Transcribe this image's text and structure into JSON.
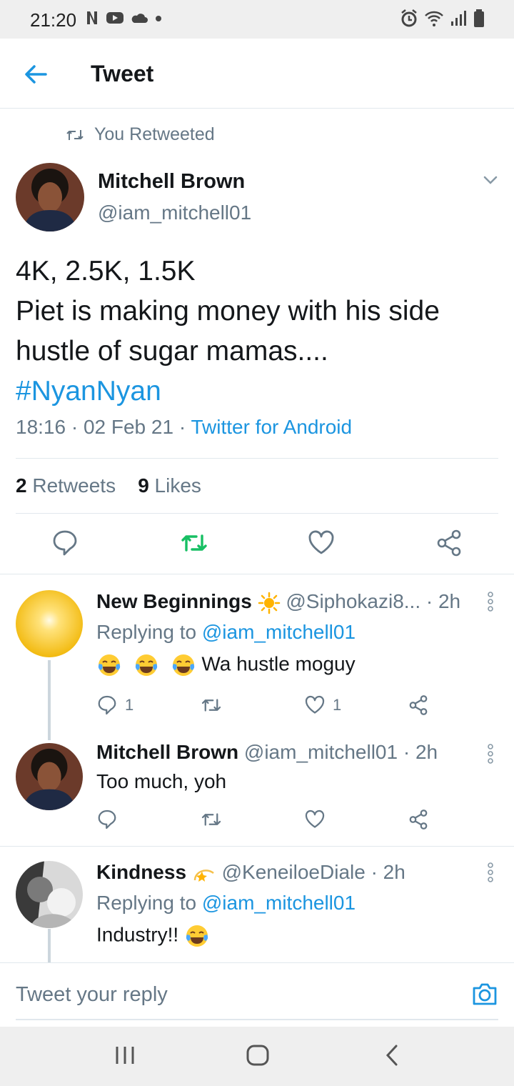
{
  "status_bar": {
    "time": "21:20"
  },
  "app_bar": {
    "title": "Tweet"
  },
  "tweet": {
    "retweet_context": "You Retweeted",
    "author_name": "Mitchell Brown",
    "author_handle": "@iam_mitchell01",
    "text_lines": [
      "4K, 2.5K, 1.5K",
      "Piet is making money with his side",
      "hustle of sugar mamas...."
    ],
    "hashtag": "#NyanNyan",
    "timestamp": "18:16 · 02 Feb 21 · ",
    "source": "Twitter for Android",
    "retweets_count": "2",
    "retweets_label": " Retweets",
    "likes_count": "9",
    "likes_label": " Likes"
  },
  "replies": [
    {
      "name": "New Beginnings",
      "handle": "@Siphokazi8... · 2h",
      "replying_prefix": "Replying to ",
      "replying_to": "@iam_mitchell01",
      "text": "Wa hustle moguy",
      "reply_count": "1",
      "like_count": "1"
    },
    {
      "name": "Mitchell Brown",
      "handle": "@iam_mitchell01 · 2h",
      "text": "Too much, yoh"
    },
    {
      "name": "Kindness",
      "handle": "@KeneiloeDiale · 2h",
      "replying_prefix": "Replying to ",
      "replying_to": "@iam_mitchell01",
      "text": "Industry!!"
    }
  ],
  "compose": {
    "placeholder": "Tweet your reply"
  },
  "colors": {
    "accent": "#1b95e0",
    "retweet_green": "#17bf63",
    "secondary_text": "#657786"
  }
}
